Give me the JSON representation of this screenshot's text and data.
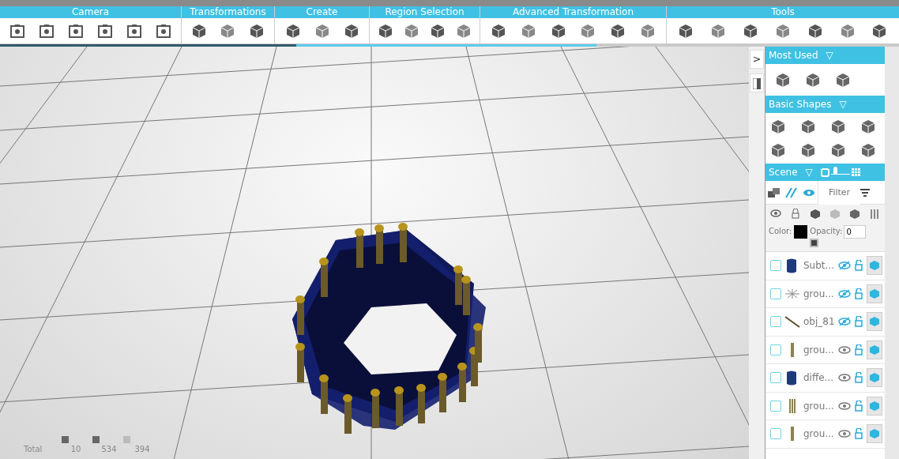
{
  "toolbar": {
    "sections": [
      {
        "label": "Camera"
      },
      {
        "label": "Transformations"
      },
      {
        "label": "Create"
      },
      {
        "label": "Region Selection"
      },
      {
        "label": "Advanced Transformation"
      },
      {
        "label": "Tools"
      }
    ]
  },
  "side_toggle": {
    "label": ">"
  },
  "panel": {
    "most_used": {
      "title": "Most Used",
      "arrow": "▽"
    },
    "basic_shapes": {
      "title": "Basic Shapes",
      "arrow": "▽"
    },
    "scene": {
      "title": "Scene",
      "arrow": "▽",
      "filter_placeholder": "Filter",
      "color_label": "Color:",
      "color": "#000000",
      "opacity_label": "Opacity:",
      "opacity": "0",
      "size_slider": {
        "level": 0.15
      },
      "objects": [
        {
          "name": "Subt...",
          "kind": "blue",
          "hidden": true,
          "checked": false
        },
        {
          "name": "grou...",
          "kind": "star",
          "hidden": true,
          "checked": false
        },
        {
          "name": "obj_81",
          "kind": "rod",
          "hidden": true,
          "checked": false
        },
        {
          "name": "grou...",
          "kind": "post",
          "hidden": false,
          "checked": false
        },
        {
          "name": "diffe...",
          "kind": "blue",
          "hidden": false,
          "checked": false
        },
        {
          "name": "grou...",
          "kind": "posts",
          "hidden": false,
          "checked": false
        },
        {
          "name": "grou...",
          "kind": "post",
          "hidden": false,
          "checked": false
        }
      ]
    }
  },
  "stats": {
    "label": "Total",
    "values": [
      "10",
      "534",
      "394"
    ]
  }
}
